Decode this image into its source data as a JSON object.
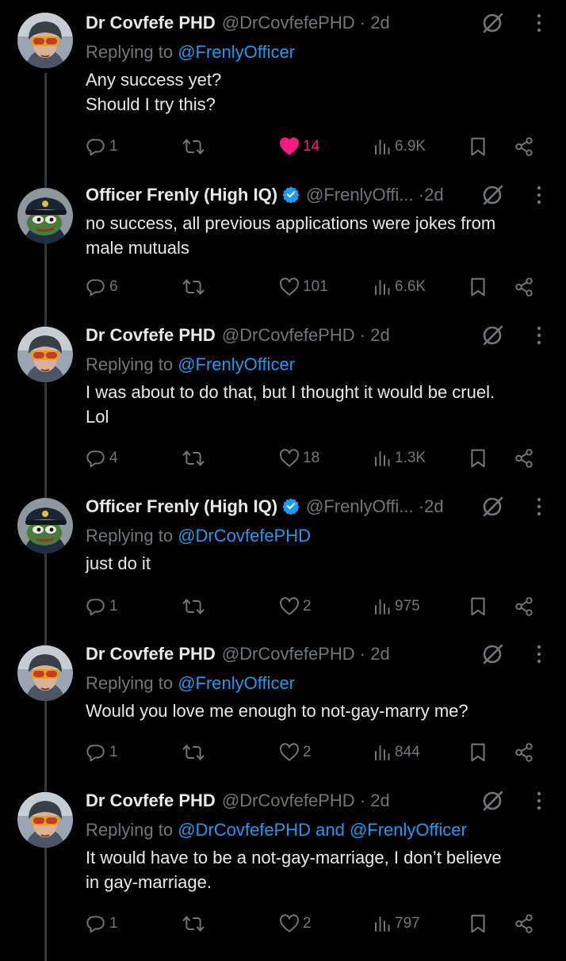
{
  "tweets": [
    {
      "avatar": "covfefe-avatar",
      "name": "Dr Covfefe PHD",
      "verified": false,
      "handle": "@DrCovfefePHD",
      "dot": "·",
      "time": "2d",
      "replying_prefix": "Replying to ",
      "replying_to": "@FrenlyOfficer",
      "replying_and": "",
      "replying_to2": "",
      "text": [
        "Any success yet?",
        "Should I try this?"
      ],
      "replies": "1",
      "likes": "14",
      "liked": true,
      "views": "6.9K"
    },
    {
      "avatar": "frenly-avatar",
      "name": "Officer Frenly (High IQ)",
      "verified": true,
      "handle": "@FrenlyOffi...",
      "dot": "·",
      "time": "2d",
      "replying_prefix": "",
      "replying_to": "",
      "replying_and": "",
      "replying_to2": "",
      "text": [
        "no success, all previous applications were jokes from",
        "male mutuals"
      ],
      "replies": "6",
      "likes": "101",
      "liked": false,
      "views": "6.6K"
    },
    {
      "avatar": "covfefe-avatar",
      "name": "Dr Covfefe PHD",
      "verified": false,
      "handle": "@DrCovfefePHD",
      "dot": "·",
      "time": "2d",
      "replying_prefix": "Replying to ",
      "replying_to": "@FrenlyOfficer",
      "replying_and": "",
      "replying_to2": "",
      "text": [
        "I was about to do that, but I thought it would be cruel.",
        "Lol"
      ],
      "replies": "4",
      "likes": "18",
      "liked": false,
      "views": "1.3K"
    },
    {
      "avatar": "frenly-avatar",
      "name": "Officer Frenly (High IQ)",
      "verified": true,
      "handle": "@FrenlyOffi...",
      "dot": "·",
      "time": "2d",
      "replying_prefix": "Replying to ",
      "replying_to": "@DrCovfefePHD",
      "replying_and": "",
      "replying_to2": "",
      "text": [
        "just do it"
      ],
      "replies": "1",
      "likes": "2",
      "liked": false,
      "views": "975"
    },
    {
      "avatar": "covfefe-avatar",
      "name": "Dr Covfefe PHD",
      "verified": false,
      "handle": "@DrCovfefePHD",
      "dot": "·",
      "time": "2d",
      "replying_prefix": "Replying to ",
      "replying_to": "@FrenlyOfficer",
      "replying_and": "",
      "replying_to2": "",
      "text": [
        "Would you love me enough to not-gay-marry me?"
      ],
      "replies": "1",
      "likes": "2",
      "liked": false,
      "views": "844"
    },
    {
      "avatar": "covfefe-avatar",
      "name": "Dr Covfefe PHD",
      "verified": false,
      "handle": "@DrCovfefePHD",
      "dot": "·",
      "time": "2d",
      "replying_prefix": "Replying to ",
      "replying_to": "@DrCovfefePHD",
      "replying_and": " and ",
      "replying_to2": "@FrenlyOfficer",
      "text": [
        "It would have to be a not-gay-marriage, I don’t believe",
        "in gay-marriage."
      ],
      "replies": "1",
      "likes": "2",
      "liked": false,
      "views": "797"
    }
  ],
  "colors": {
    "background": "#000000",
    "primary_text": "#e7e9ea",
    "secondary_text": "#71767b",
    "link": "#1d9bf0",
    "like_active": "#f91880",
    "verified_badge": "#1d9bf0"
  },
  "icons": [
    "reply-icon",
    "retweet-icon",
    "like-icon",
    "views-icon",
    "bookmark-icon",
    "share-icon",
    "grok-icon",
    "more-icon",
    "verified-icon"
  ]
}
